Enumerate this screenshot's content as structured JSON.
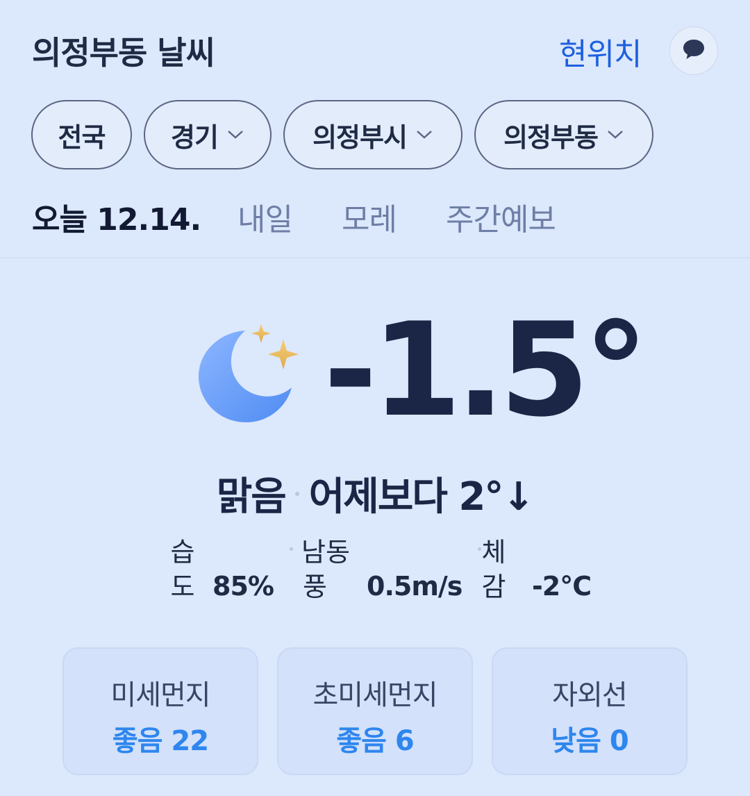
{
  "header": {
    "title": "의정부동 날씨",
    "location_link": "현위치",
    "chat_icon": "chat-bubble-icon"
  },
  "regions": [
    {
      "label": "전국",
      "has_dropdown": false
    },
    {
      "label": "경기",
      "has_dropdown": true
    },
    {
      "label": "의정부시",
      "has_dropdown": true
    },
    {
      "label": "의정부동",
      "has_dropdown": true
    }
  ],
  "tabs": [
    {
      "label": "오늘 12.14.",
      "active": true
    },
    {
      "label": "내일",
      "active": false
    },
    {
      "label": "모레",
      "active": false
    },
    {
      "label": "주간예보",
      "active": false
    }
  ],
  "current": {
    "icon": "clear-night-moon-icon",
    "temperature": "-1.5°",
    "condition": "맑음",
    "comparison": "어제보다 2°↓"
  },
  "details": [
    {
      "label_top": "습",
      "label_bottom": "도",
      "value": "85%"
    },
    {
      "label_top": "남동",
      "label_bottom": "풍",
      "value": "0.5m/s"
    },
    {
      "label_top": "체",
      "label_bottom": "감",
      "value": "-2°C"
    }
  ],
  "air": [
    {
      "title": "미세먼지",
      "value": "좋음 22"
    },
    {
      "title": "초미세먼지",
      "value": "좋음 6"
    },
    {
      "title": "자외선",
      "value": "낮음 0"
    }
  ],
  "colors": {
    "background": "#dce8fb",
    "accent_link": "#1d5fe0",
    "good_status": "#2e86ee",
    "text_dark": "#1b2545"
  }
}
